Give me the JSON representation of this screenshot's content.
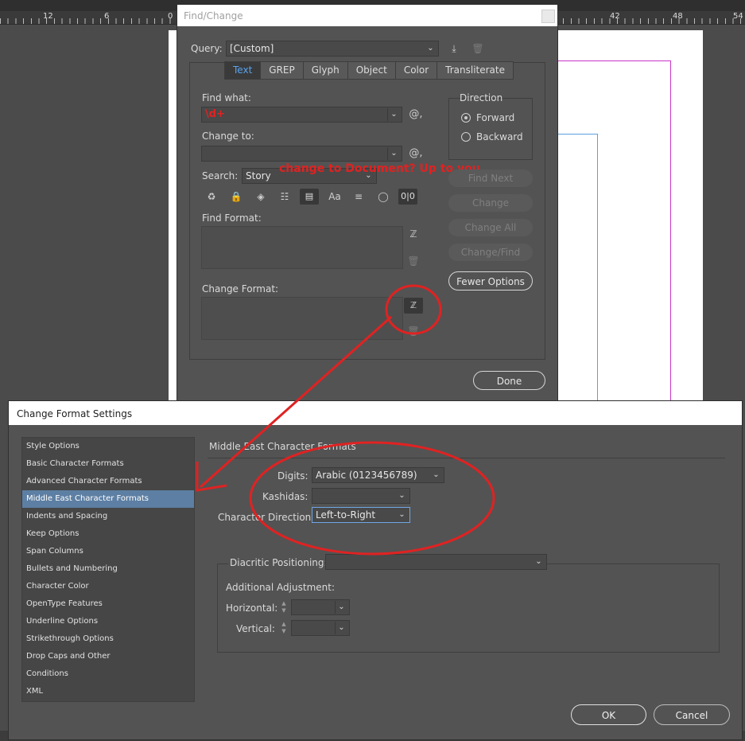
{
  "ruler": {
    "ticks": [
      "12",
      "6",
      "0",
      "42",
      "48",
      "54"
    ]
  },
  "find_change": {
    "title": "Find/Change",
    "query_label": "Query:",
    "query_value": "[Custom]",
    "tabs": [
      "Text",
      "GREP",
      "Glyph",
      "Object",
      "Color",
      "Transliterate"
    ],
    "active_tab": "Text",
    "find_what_label": "Find what:",
    "find_what_value": "\\d+",
    "change_to_label": "Change to:",
    "change_to_value": "",
    "search_label": "Search:",
    "search_value": "Story",
    "direction": {
      "label": "Direction",
      "options": [
        "Forward",
        "Backward"
      ],
      "selected": "Forward"
    },
    "buttons": {
      "find_next": "Find Next",
      "change": "Change",
      "change_all": "Change All",
      "change_find": "Change/Find",
      "fewer_options": "Fewer Options",
      "done": "Done"
    },
    "find_format_label": "Find Format:",
    "change_format_label": "Change Format:",
    "annotation": "change to Document? Up to you"
  },
  "format_settings": {
    "title": "Change Format Settings",
    "categories": [
      "Style Options",
      "Basic Character Formats",
      "Advanced Character Formats",
      "Middle East Character Formats",
      "Indents and Spacing",
      "Keep Options",
      "Span Columns",
      "Bullets and Numbering",
      "Character Color",
      "OpenType Features",
      "Underline Options",
      "Strikethrough Options",
      "Drop Caps and Other",
      "Conditions",
      "XML"
    ],
    "selected_category": "Middle East Character Formats",
    "section_title": "Middle East Character Formats",
    "digits_label": "Digits:",
    "digits_value": "Arabic (0123456789)",
    "kashidas_label": "Kashidas:",
    "kashidas_value": "",
    "char_direction_label": "Character Direction:",
    "char_direction_value": "Left-to-Right",
    "diacritic_label": "Diacritic Positioning:",
    "diacritic_value": "",
    "additional_label": "Additional Adjustment:",
    "horizontal_label": "Horizontal:",
    "vertical_label": "Vertical:",
    "ok": "OK",
    "cancel": "Cancel"
  },
  "colors": {
    "accent": "#57a3f0",
    "annotation": "#e02222",
    "selection": "#5d7fa3"
  }
}
